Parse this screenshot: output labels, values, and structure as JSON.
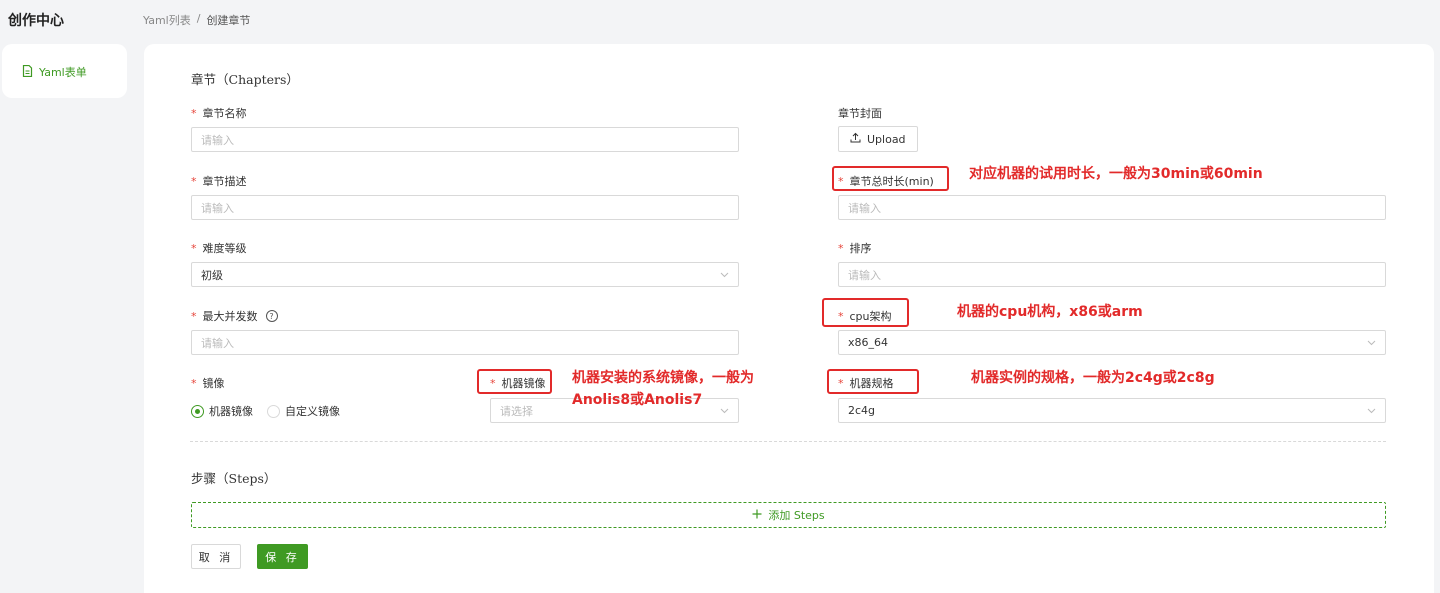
{
  "app": {
    "title": "创作中心"
  },
  "breadcrumb": {
    "parent": "Yaml列表",
    "separator": "/",
    "current": "创建章节"
  },
  "sidebar": {
    "items": [
      {
        "label": "Yaml表单",
        "icon": "file-icon"
      }
    ]
  },
  "colors": {
    "accent": "#3f9a23",
    "required": "#e6443a",
    "annotation": "#e22a2a"
  },
  "chapters": {
    "title": "章节（Chapters）",
    "fields": {
      "name": {
        "label": "章节名称",
        "placeholder": "请输入"
      },
      "cover": {
        "label": "章节封面",
        "button": "Upload"
      },
      "desc": {
        "label": "章节描述",
        "placeholder": "请输入"
      },
      "duration": {
        "label": "章节总时长(min)",
        "placeholder": "请输入"
      },
      "difficulty": {
        "label": "难度等级",
        "value": "初级"
      },
      "order": {
        "label": "排序",
        "placeholder": "请输入"
      },
      "concurrency": {
        "label": "最大并发数",
        "placeholder": "请输入",
        "help": "?"
      },
      "cpu": {
        "label": "cpu架构",
        "value": "x86_64"
      },
      "image": {
        "label": "镜像",
        "options": [
          "机器镜像",
          "自定义镜像"
        ],
        "selected": "机器镜像"
      },
      "machine_image": {
        "label": "机器镜像",
        "placeholder": "请选择"
      },
      "spec": {
        "label": "机器规格",
        "value": "2c4g"
      }
    }
  },
  "steps": {
    "title": "步骤（Steps）",
    "add_label": "添加 Steps"
  },
  "actions": {
    "cancel": "取 消",
    "save": "保 存"
  },
  "annotations": {
    "duration_note": "对应机器的试用时长，一般为30min或60min",
    "cpu_note": "机器的cpu机构，x86或arm",
    "image_note_1": "机器安装的系统镜像，一般为",
    "image_note_2": "Anolis8或Anolis7",
    "spec_note": "机器实例的规格，一般为2c4g或2c8g"
  }
}
